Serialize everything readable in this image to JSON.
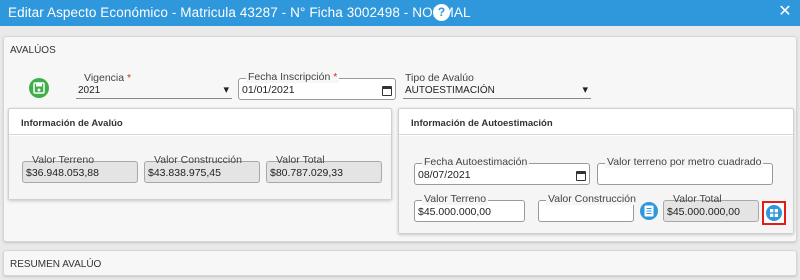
{
  "window": {
    "title": "Editar Aspecto Económico - Matricula 43287 - N° Ficha 3002498 - NORMAL",
    "help_icon_glyph": "?",
    "close_icon_glyph": "✕"
  },
  "avaluos": {
    "header": "AVALÚOS",
    "vigencia": {
      "label": "Vigencia",
      "required_mark": "*",
      "value": "2021"
    },
    "fecha_inscripcion": {
      "label": "Fecha Inscripción",
      "required_mark": "*",
      "value": "01/01/2021"
    },
    "tipo_avaluo": {
      "label": "Tipo de Avalúo",
      "value": "AUTOESTIMACIÓN"
    },
    "informacion_avaluo": {
      "title": "Información de Avalúo",
      "valor_terreno": {
        "label": "Valor Terreno",
        "value": "$36.948.053,88"
      },
      "valor_construccion": {
        "label": "Valor Construcción",
        "value": "$43.838.975,45"
      },
      "valor_total": {
        "label": "Valor Total",
        "value": "$80.787.029,33"
      }
    },
    "informacion_autoestimacion": {
      "title": "Información de Autoestimación",
      "fecha_autoestimacion": {
        "label": "Fecha Autoestimación",
        "value": "08/07/2021"
      },
      "valor_terreno_m2": {
        "label": "Valor terreno por metro cuadrado",
        "value": ""
      },
      "valor_terreno": {
        "label": "Valor Terreno",
        "value": "$45.000.000,00"
      },
      "valor_construccion": {
        "label": "Valor Construcción",
        "value": ""
      },
      "valor_total": {
        "label": "Valor Total",
        "value": "$45.000.000,00"
      }
    }
  },
  "resumen": {
    "header": "RESUMEN AVALÚO"
  },
  "colors": {
    "titlebar": "#2f97db",
    "save_button": "#3fae4b",
    "action_button": "#2f97db",
    "required": "#d9291c",
    "highlight_border": "#e21b1b"
  },
  "chevron_glyph": "▾"
}
